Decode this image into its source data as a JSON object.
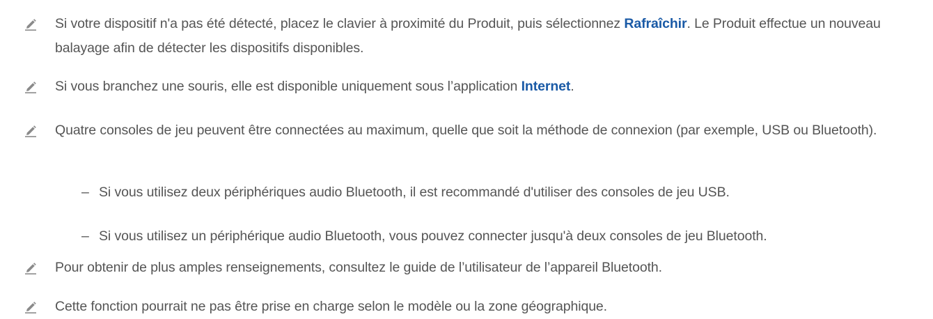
{
  "colors": {
    "text": "#555555",
    "link": "#1a5aa6",
    "icon": "#8a8a8a"
  },
  "icon_name": "pencil-note-icon",
  "notes": [
    {
      "before": "Si votre dispositif n'a pas été détecté, placez le clavier à proximité du Produit, puis sélectionnez ",
      "link": "Rafraîchir",
      "after": ". Le Produit effectue un nouveau balayage afin de détecter les dispositifs disponibles."
    },
    {
      "before": "Si vous branchez une souris, elle est disponible uniquement sous l’application ",
      "link": "Internet",
      "after": "."
    },
    {
      "text": "Quatre consoles de jeu peuvent être connectées au maximum, quelle que soit la méthode de connexion (par exemple, USB ou Bluetooth)."
    },
    {
      "text": "Pour obtenir de plus amples renseignements, consultez le guide de l’utilisateur de l’appareil Bluetooth."
    },
    {
      "text": "Cette fonction pourrait ne pas être prise en charge selon le modèle ou la zone géographique."
    }
  ],
  "sub_items": [
    {
      "dash": "–",
      "text": "Si vous utilisez deux périphériques audio Bluetooth, il est recommandé d'utiliser des consoles de jeu USB."
    },
    {
      "dash": "–",
      "text": "Si vous utilisez un périphérique audio Bluetooth, vous pouvez connecter jusqu'à deux consoles de jeu Bluetooth."
    }
  ]
}
